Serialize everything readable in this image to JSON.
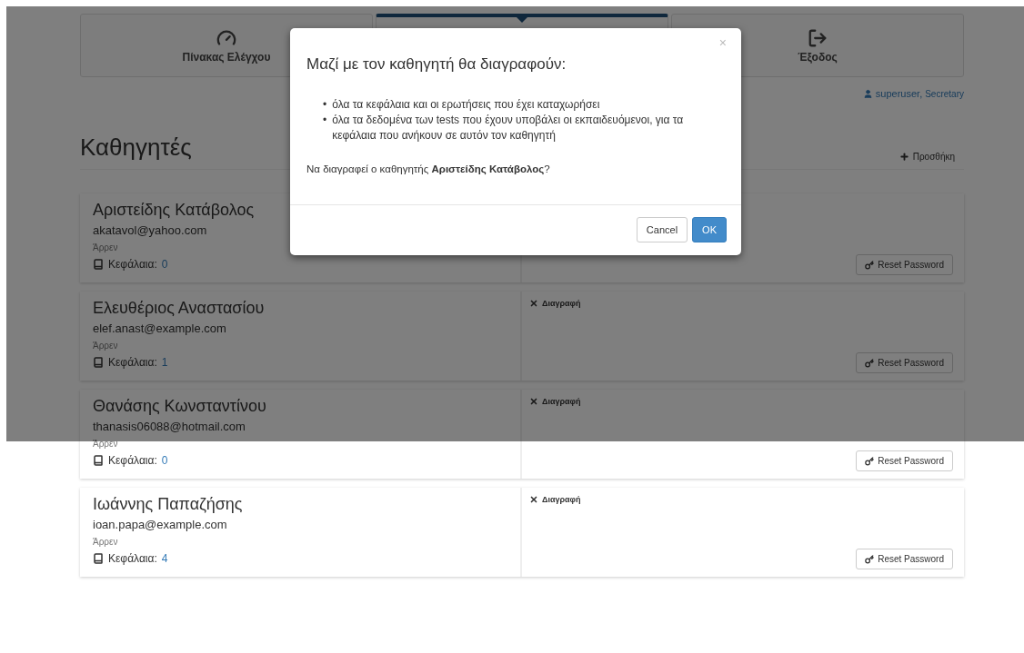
{
  "nav": {
    "tabs": [
      {
        "kind": "dashboard",
        "label": "Πίνακας Ελέγχου",
        "selected": false
      },
      {
        "kind": "hidden",
        "selected": true
      },
      {
        "kind": "logout",
        "label": "Έξοδος",
        "selected": false
      }
    ]
  },
  "user": {
    "name": "superuser,",
    "role": "Secretary"
  },
  "heading": "Καθηγητές",
  "add_button": "Προσθήκη",
  "teachers": [
    {
      "name": "Αριστείδης Κατάβολος",
      "email": "akatavol@yahoo.com",
      "gender": "Άρρεν",
      "chapters_label": "Κεφάλαια:",
      "chapters": "0",
      "reset_button": "Reset Password"
    },
    {
      "name": "Ελευθέριος Αναστασίου",
      "email": "elef.anast@example.com",
      "gender": "Άρρεν",
      "chapters_label": "Κεφάλαια:",
      "chapters": "1",
      "delete": "Διαγραφή",
      "reset_button": "Reset Password"
    },
    {
      "name": "Θανάσης Κωνσταντίνου",
      "email": "thanasis06088@hotmail.com",
      "gender": "Άρρεν",
      "chapters_label": "Κεφάλαια:",
      "chapters": "0",
      "delete": "Διαγραφή",
      "reset_button": "Reset Password"
    },
    {
      "name": "Ιωάννης Παπαζήσης",
      "email": "ioan.papa@example.com",
      "gender": "Άρρεν",
      "chapters_label": "Κεφάλαια:",
      "chapters": "4",
      "delete": "Διαγραφή",
      "reset_button": "Reset Password"
    }
  ],
  "dialog": {
    "close": "×",
    "title": "Μαζί με τον καθηγητή θα διαγραφούν:",
    "items": [
      {
        "bullet": "•",
        "text": "όλα τα κεφάλαια και οι ερωτήσεις που έχει καταχωρήσει"
      },
      {
        "bullet": "•",
        "text": "όλα τα δεδομένα των tests που έχουν υποβάλει οι εκπαιδευόμενοι, για τα κεφάλαια που ανήκουν σε αυτόν τον καθηγητή"
      }
    ],
    "question": "Να διαγραφεί ο καθηγητής **Αριστείδης Κατάβολος**?",
    "buttons": [
      {
        "kind": "default",
        "label": "Cancel"
      },
      {
        "kind": "primary",
        "label": "OK"
      }
    ]
  }
}
